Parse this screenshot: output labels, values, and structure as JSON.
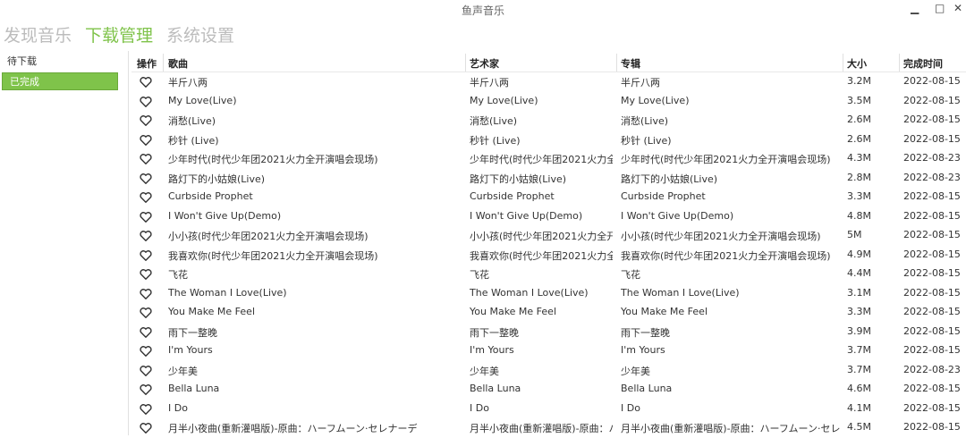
{
  "window": {
    "title": "鱼声音乐",
    "minimize": "▁",
    "maximize": "□",
    "close": "✕"
  },
  "nav": {
    "tabs": [
      {
        "label": "发现音乐"
      },
      {
        "label": "下载管理"
      },
      {
        "label": "系统设置"
      }
    ],
    "active": "下载管理"
  },
  "sidebar": {
    "items": [
      {
        "label": "待下载"
      },
      {
        "label": "已完成"
      }
    ],
    "active": "已完成"
  },
  "table": {
    "columns": {
      "action": "操作",
      "song": "歌曲",
      "artist": "艺术家",
      "album": "专辑",
      "size": "大小",
      "date": "完成时间"
    },
    "rows": [
      {
        "song": "半斤八两",
        "artist": "半斤八两",
        "album": "半斤八两",
        "size": "3.2M",
        "date": "2022-08-15"
      },
      {
        "song": "My Love(Live)",
        "artist": "My Love(Live)",
        "album": "My Love(Live)",
        "size": "3.5M",
        "date": "2022-08-15"
      },
      {
        "song": "消愁(Live)",
        "artist": "消愁(Live)",
        "album": "消愁(Live)",
        "size": "2.6M",
        "date": "2022-08-15"
      },
      {
        "song": "秒针 (Live)",
        "artist": "秒针 (Live)",
        "album": "秒针 (Live)",
        "size": "2.6M",
        "date": "2022-08-15"
      },
      {
        "song": "少年时代(时代少年团2021火力全开演唱会现场)",
        "artist": "少年时代(时代少年团2021火力全开",
        "album": "少年时代(时代少年团2021火力全开演唱会现场)",
        "size": "4.3M",
        "date": "2022-08-23"
      },
      {
        "song": "路灯下的小姑娘(Live)",
        "artist": "路灯下的小姑娘(Live)",
        "album": "路灯下的小姑娘(Live)",
        "size": "2.8M",
        "date": "2022-08-23"
      },
      {
        "song": "Curbside Prophet",
        "artist": "Curbside Prophet",
        "album": "Curbside Prophet",
        "size": "3.3M",
        "date": "2022-08-15"
      },
      {
        "song": "I Won't Give Up(Demo)",
        "artist": "I Won't Give Up(Demo)",
        "album": "I Won't Give Up(Demo)",
        "size": "4.8M",
        "date": "2022-08-15"
      },
      {
        "song": "小小孩(时代少年团2021火力全开演唱会现场)",
        "artist": "小小孩(时代少年团2021火力全开演",
        "album": "小小孩(时代少年团2021火力全开演唱会现场)",
        "size": "5M",
        "date": "2022-08-15"
      },
      {
        "song": "我喜欢你(时代少年团2021火力全开演唱会现场)",
        "artist": "我喜欢你(时代少年团2021火力全开",
        "album": "我喜欢你(时代少年团2021火力全开演唱会现场)",
        "size": "4.9M",
        "date": "2022-08-15"
      },
      {
        "song": "飞花",
        "artist": "飞花",
        "album": "飞花",
        "size": "4.4M",
        "date": "2022-08-15"
      },
      {
        "song": "The Woman I Love(Live)",
        "artist": "The Woman I Love(Live)",
        "album": "The Woman I Love(Live)",
        "size": "3.1M",
        "date": "2022-08-15"
      },
      {
        "song": "You Make Me Feel",
        "artist": "You Make Me Feel",
        "album": "You Make Me Feel",
        "size": "3.3M",
        "date": "2022-08-15"
      },
      {
        "song": "雨下一整晚",
        "artist": "雨下一整晚",
        "album": "雨下一整晚",
        "size": "3.9M",
        "date": "2022-08-15"
      },
      {
        "song": "I'm Yours",
        "artist": "I'm Yours",
        "album": "I'm Yours",
        "size": "3.7M",
        "date": "2022-08-15"
      },
      {
        "song": "少年美",
        "artist": "少年美",
        "album": "少年美",
        "size": "3.7M",
        "date": "2022-08-23"
      },
      {
        "song": "Bella Luna",
        "artist": "Bella Luna",
        "album": "Bella Luna",
        "size": "4.6M",
        "date": "2022-08-15"
      },
      {
        "song": "I Do",
        "artist": "I Do",
        "album": "I Do",
        "size": "4.1M",
        "date": "2022-08-15"
      },
      {
        "song": "月半小夜曲(重新灌唱版)-原曲：ハーフムーン·セレナーデ",
        "artist": "月半小夜曲(重新灌唱版)-原曲：ハ",
        "album": "月半小夜曲(重新灌唱版)-原曲：ハーフムーン·セレナーデ",
        "size": "4.5M",
        "date": "2022-08-15"
      }
    ]
  }
}
